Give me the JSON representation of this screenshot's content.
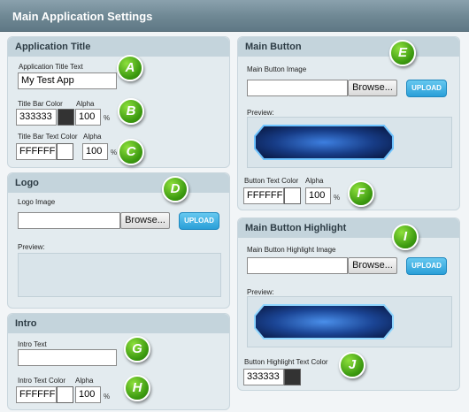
{
  "window": {
    "title": "Main Application Settings"
  },
  "app_title": {
    "heading": "Application Title",
    "text_label": "Application Title Text",
    "text_value": "My Test App",
    "bar_color_label": "Title Bar Color",
    "bar_color_value": "333333",
    "bar_color_swatch": "#333333",
    "alpha_label": "Alpha",
    "bar_alpha_value": "100",
    "pct": "%",
    "bar_text_color_label": "Title Bar Text Color",
    "bar_text_color_value": "FFFFFF",
    "bar_text_color_swatch": "#FFFFFF",
    "bar_text_alpha_value": "100"
  },
  "logo": {
    "heading": "Logo",
    "image_label": "Logo Image",
    "browse_label": "Browse...",
    "upload_label": "UPLOAD",
    "preview_label": "Preview:"
  },
  "intro": {
    "heading": "Intro",
    "text_label": "Intro Text",
    "text_value": "",
    "text_color_label": "Intro Text Color",
    "alpha_label": "Alpha",
    "text_color_value": "FFFFFF",
    "text_color_swatch": "#FFFFFF",
    "alpha_value": "100",
    "pct": "%"
  },
  "main_button": {
    "heading": "Main Button",
    "image_label": "Main Button Image",
    "browse_label": "Browse...",
    "upload_label": "UPLOAD",
    "preview_label": "Preview:",
    "text_color_label": "Button Text Color",
    "alpha_label": "Alpha",
    "text_color_value": "FFFFFF",
    "text_color_swatch": "#FFFFFF",
    "alpha_value": "100",
    "pct": "%"
  },
  "main_button_highlight": {
    "heading": "Main Button Highlight",
    "image_label": "Main Button Highlight Image",
    "browse_label": "Browse...",
    "upload_label": "UPLOAD",
    "preview_label": "Preview:",
    "text_color_label": "Button Highlight Text Color",
    "text_color_value": "333333",
    "text_color_swatch": "#333333"
  },
  "badges": {
    "a": "A",
    "b": "B",
    "c": "C",
    "d": "D",
    "e": "E",
    "f": "F",
    "g": "G",
    "h": "H",
    "i": "I",
    "j": "J"
  },
  "colors": {
    "badge_green": "#4cae14",
    "upload_blue": "#2a9fd8",
    "title_bar": "#6e8793",
    "panel_bg": "#e3ebef"
  }
}
